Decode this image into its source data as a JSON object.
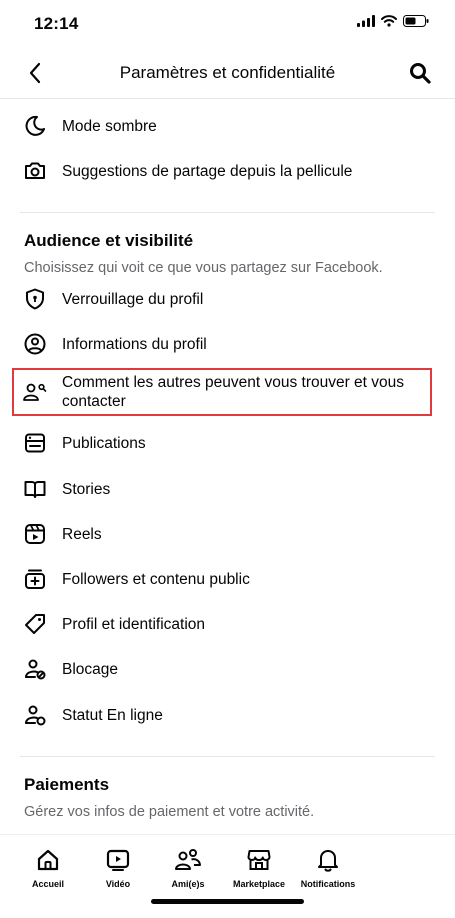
{
  "status": {
    "time": "12:14",
    "icons": [
      "signal-icon",
      "wifi-icon",
      "battery-icon"
    ]
  },
  "header": {
    "title": "Paramètres et confidentialité",
    "back_icon": "chevron-left-icon",
    "search_icon": "search-icon"
  },
  "top_items": [
    {
      "label": "Mode sombre",
      "icon": "moon-icon"
    },
    {
      "label": "Suggestions de partage depuis la pellicule",
      "icon": "camera-icon"
    }
  ],
  "audience": {
    "title": "Audience et visibilité",
    "subtitle": "Choisissez qui voit ce que vous partagez sur Facebook.",
    "items": [
      {
        "label": "Verrouillage du profil",
        "icon": "shield-icon"
      },
      {
        "label": "Informations du profil",
        "icon": "user-circle-icon"
      },
      {
        "label": "Comment les autres peuvent vous trouver et vous contacter",
        "icon": "user-search-icon",
        "highlighted": true
      },
      {
        "label": "Publications",
        "icon": "posts-icon"
      },
      {
        "label": "Stories",
        "icon": "book-icon"
      },
      {
        "label": "Reels",
        "icon": "reels-icon"
      },
      {
        "label": "Followers et contenu public",
        "icon": "followers-icon"
      },
      {
        "label": "Profil et identification",
        "icon": "tag-icon"
      },
      {
        "label": "Blocage",
        "icon": "user-block-icon"
      },
      {
        "label": "Statut En ligne",
        "icon": "user-online-icon"
      }
    ]
  },
  "payments": {
    "title": "Paiements",
    "subtitle": "Gérez vos infos de paiement et votre activité."
  },
  "tabs": [
    {
      "label": "Accueil",
      "icon": "home-icon"
    },
    {
      "label": "Vidéo",
      "icon": "video-icon"
    },
    {
      "label": "Ami(e)s",
      "icon": "friends-icon"
    },
    {
      "label": "Marketplace",
      "icon": "marketplace-icon"
    },
    {
      "label": "Notifications",
      "icon": "bell-icon"
    }
  ],
  "colors": {
    "highlight": "#e0393e",
    "text": "#050505",
    "secondary": "#65676b",
    "divider": "#e4e6eb"
  }
}
